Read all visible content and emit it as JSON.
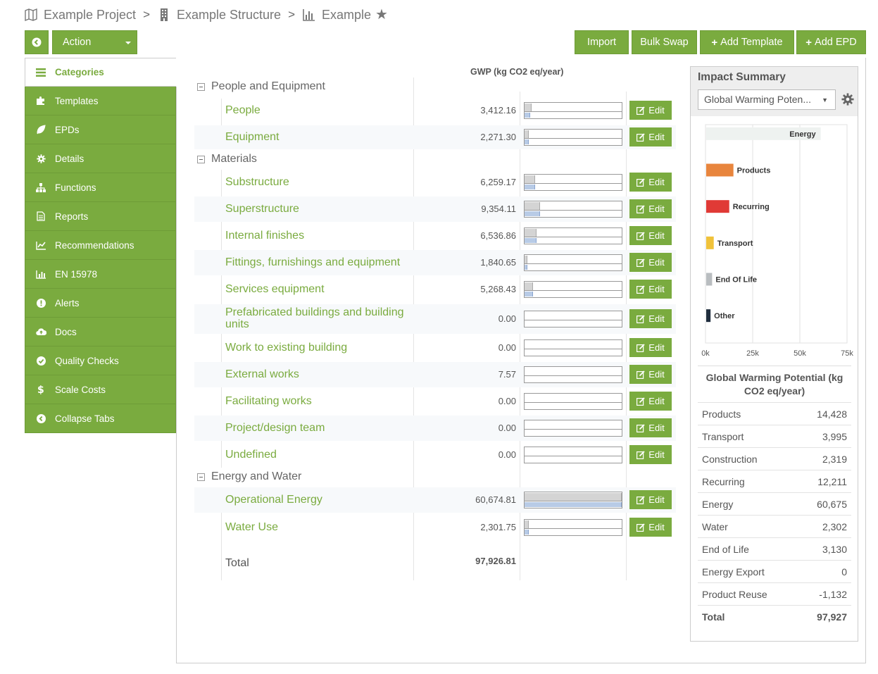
{
  "breadcrumb": {
    "project": "Example Project",
    "structure": "Example Structure",
    "page": "Example",
    "separator": ">"
  },
  "toolbar": {
    "action_label": "Action",
    "import_label": "Import",
    "bulk_swap_label": "Bulk Swap",
    "add_template_label": "Add Template",
    "add_epd_label": "Add EPD"
  },
  "sidebar": {
    "items": [
      {
        "label": "Categories",
        "icon": "list-icon"
      },
      {
        "label": "Templates",
        "icon": "puzzle-icon"
      },
      {
        "label": "EPDs",
        "icon": "leaf-icon"
      },
      {
        "label": "Details",
        "icon": "gear-icon"
      },
      {
        "label": "Functions",
        "icon": "sitemap-icon"
      },
      {
        "label": "Reports",
        "icon": "file-icon"
      },
      {
        "label": "Recommendations",
        "icon": "line-chart-icon"
      },
      {
        "label": "EN 15978",
        "icon": "bar-chart-icon"
      },
      {
        "label": "Alerts",
        "icon": "exclamation-icon"
      },
      {
        "label": "Docs",
        "icon": "cloud-upload-icon"
      },
      {
        "label": "Quality Checks",
        "icon": "check-circle-icon"
      },
      {
        "label": "Scale Costs",
        "icon": "dollar-icon"
      },
      {
        "label": "Collapse Tabs",
        "icon": "chevron-left-circle-icon"
      }
    ]
  },
  "table": {
    "column_header": "GWP (kg CO2 eq/year)",
    "edit_label": "Edit",
    "groups": [
      {
        "name": "People and Equipment"
      },
      {
        "name": "Materials"
      },
      {
        "name": "Energy and Water"
      }
    ],
    "rows": [
      {
        "label": "People",
        "value": "3,412.16",
        "bar_top": 0.07,
        "bar_bottom": 0.06
      },
      {
        "label": "Equipment",
        "value": "2,271.30",
        "bar_top": 0.04,
        "bar_bottom": 0.04
      },
      {
        "label": "Substructure",
        "value": "6,259.17",
        "bar_top": 0.11,
        "bar_bottom": 0.11
      },
      {
        "label": "Superstructure",
        "value": "9,354.11",
        "bar_top": 0.16,
        "bar_bottom": 0.16
      },
      {
        "label": "Internal finishes",
        "value": "6,536.86",
        "bar_top": 0.12,
        "bar_bottom": 0.12
      },
      {
        "label": "Fittings, furnishings and equipment",
        "value": "1,840.65",
        "bar_top": 0.03,
        "bar_bottom": 0.03
      },
      {
        "label": "Services equipment",
        "value": "5,268.43",
        "bar_top": 0.09,
        "bar_bottom": 0.09
      },
      {
        "label": "Prefabricated buildings and building units",
        "value": "0.00",
        "bar_top": 0,
        "bar_bottom": 0
      },
      {
        "label": "Work to existing building",
        "value": "0.00",
        "bar_top": 0,
        "bar_bottom": 0
      },
      {
        "label": "External works",
        "value": "7.57",
        "bar_top": 0,
        "bar_bottom": 0
      },
      {
        "label": "Facilitating works",
        "value": "0.00",
        "bar_top": 0,
        "bar_bottom": 0
      },
      {
        "label": "Project/design team",
        "value": "0.00",
        "bar_top": 0,
        "bar_bottom": 0
      },
      {
        "label": "Undefined",
        "value": "0.00",
        "bar_top": 0,
        "bar_bottom": 0
      },
      {
        "label": "Operational Energy",
        "value": "60,674.81",
        "bar_top": 1.0,
        "bar_bottom": 1.0
      },
      {
        "label": "Water Use",
        "value": "2,301.75",
        "bar_top": 0.04,
        "bar_bottom": 0.04
      }
    ],
    "total_label": "Total",
    "total_value": "97,926.81"
  },
  "impact": {
    "title": "Impact Summary",
    "selected_indicator": "Global Warming Poten...",
    "table_title": "Global Warming Potential (kg CO2 eq/year)",
    "rows": [
      {
        "label": "Products",
        "value": "14,428"
      },
      {
        "label": "Transport",
        "value": "3,995"
      },
      {
        "label": "Construction",
        "value": "2,319"
      },
      {
        "label": "Recurring",
        "value": "12,211"
      },
      {
        "label": "Energy",
        "value": "60,675"
      },
      {
        "label": "Water",
        "value": "2,302"
      },
      {
        "label": "End of Life",
        "value": "3,130"
      },
      {
        "label": "Energy Export",
        "value": "0"
      },
      {
        "label": "Product Reuse",
        "value": "-1,132"
      }
    ],
    "total_label": "Total",
    "total_value": "97,927"
  },
  "chart_data": {
    "type": "bar",
    "orientation": "horizontal",
    "categories": [
      "Energy",
      "Products",
      "Recurring",
      "Transport",
      "End Of Life",
      "Other"
    ],
    "values": [
      60675,
      14428,
      12211,
      3995,
      3130,
      2302
    ],
    "colors": [
      "#eef2f0",
      "#e8853d",
      "#e03a36",
      "#f0c23a",
      "#b9bdc0",
      "#1f2d3d"
    ],
    "x_ticks": [
      "0k",
      "25k",
      "50k",
      "75k"
    ],
    "xlim": [
      0,
      75000
    ],
    "grid": true
  },
  "colors": {
    "accent": "#7aab3f",
    "label_green": "#7aab3f"
  }
}
